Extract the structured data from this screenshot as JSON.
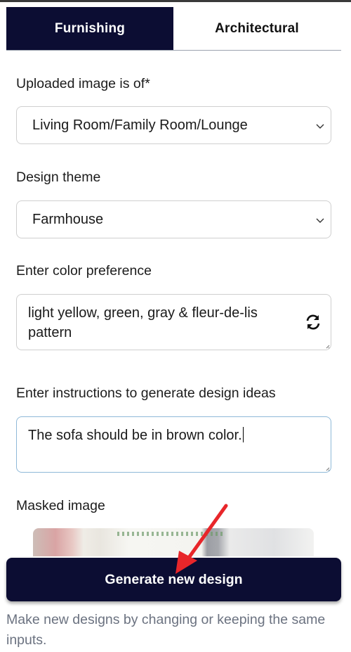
{
  "tabs": [
    {
      "label": "Furnishing",
      "active": true
    },
    {
      "label": "Architectural",
      "active": false
    }
  ],
  "room_type": {
    "label": "Uploaded image is of*",
    "value": "Living Room/Family Room/Lounge"
  },
  "design_theme": {
    "label": "Design theme",
    "value": "Farmhouse"
  },
  "color_preference": {
    "label": "Enter color preference",
    "value": "light yellow, green, gray & fleur-de-lis pattern"
  },
  "instructions": {
    "label": "Enter instructions to generate design ideas",
    "value": "The sofa should be in brown color."
  },
  "masked_image": {
    "label": "Masked image"
  },
  "generate_button": {
    "label": "Generate new design"
  },
  "hint": "Make new designs by changing or keeping the same inputs.",
  "colors": {
    "primary": "#0c0d33",
    "annotation_arrow": "#e8262a",
    "focus_border": "#8fb9d8"
  }
}
